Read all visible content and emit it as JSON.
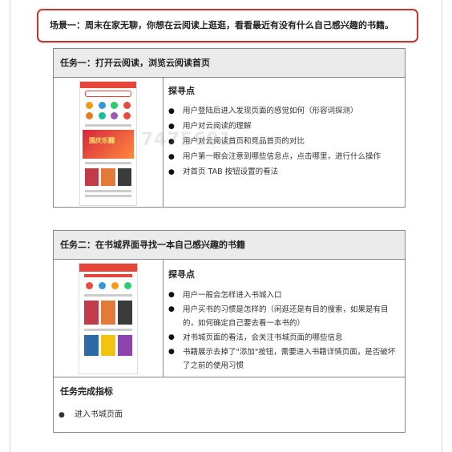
{
  "scenario": {
    "text": "场景一：周末在家无聊，你想在云阅读上逛逛，看看最近有没有什么自己感兴趣的书籍。"
  },
  "task1": {
    "title": "任务一：打开云阅读，浏览云阅读首页",
    "probe_title": "探寻点",
    "points": [
      "用户登陆后进入发现页面的感觉如何（形容词探测）",
      "用户对云阅读的理解",
      "用户对云阅读首页和竞品首页的对比",
      "用户第一眼会注意到哪些信息点，点击哪里，进行什么操作",
      "对首页 TAB 按钮设置的看法"
    ]
  },
  "task2": {
    "title": "任务二：在书城界面寻找一本自己感兴趣的书籍",
    "probe_title": "探寻点",
    "points": [
      "用户一般会怎样进入书城入口",
      "用户买书的习惯是怎样的（闲逛还是有目的搜索，如果是有目的，如何确定自己要去看一本书的）",
      "对书城页面的看法，会关注书城页面的哪些信息",
      "书籍展示去掉了\"添加\"按钮，需要进入书籍详情页面，是否破坏了之前的使用习惯"
    ],
    "metric_title": "任务完成指标",
    "metrics": [
      "进入书城页面"
    ]
  },
  "watermark": "7475601",
  "colors": {
    "scenario_border": "#c0392b",
    "app_red": "#e6453a"
  }
}
